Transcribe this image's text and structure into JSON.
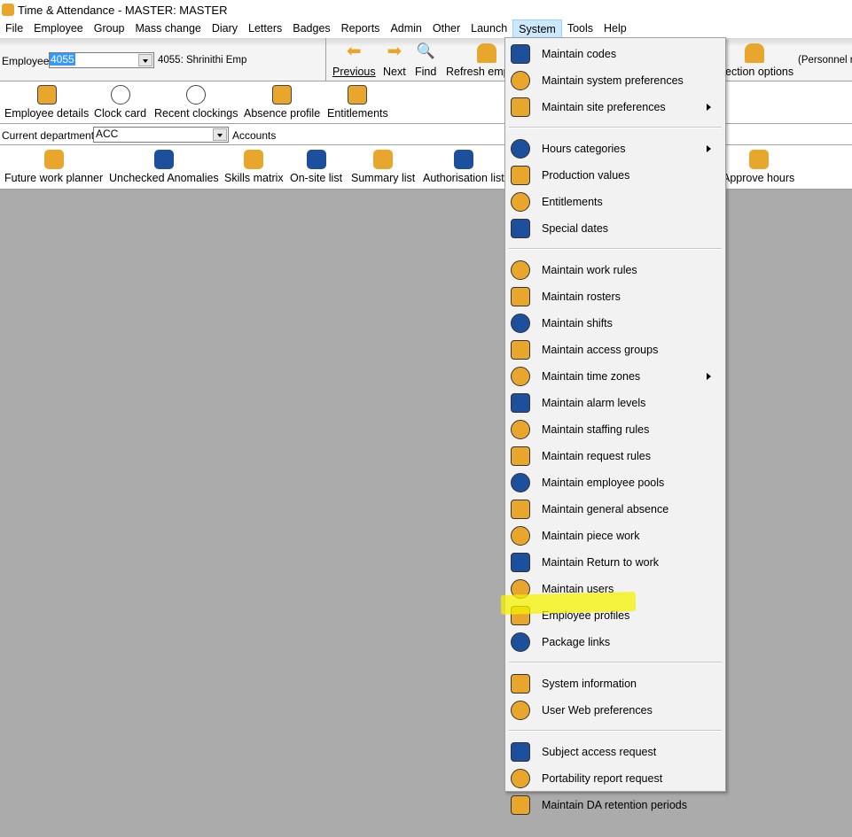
{
  "window": {
    "title": "Time & Attendance - MASTER: MASTER"
  },
  "menubar": [
    "File",
    "Employee",
    "Group",
    "Mass change",
    "Diary",
    "Letters",
    "Badges",
    "Reports",
    "Admin",
    "Other",
    "Launch",
    "System",
    "Tools",
    "Help"
  ],
  "employee": {
    "label": "Employee:",
    "value": "4055",
    "name": "4055: Shrinithi Emp"
  },
  "nav": {
    "previous": "Previous",
    "next": "Next",
    "find": "Find",
    "refresh": "Refresh emp",
    "selection": "ection options",
    "personnel": "(Personnel re"
  },
  "toolbar2": [
    "Employee details",
    "Clock card",
    "Recent clockings",
    "Absence profile",
    "Entitlements"
  ],
  "department": {
    "label": "Current department:",
    "value": "ACC",
    "name": "Accounts"
  },
  "toolbar3": [
    "Future work planner",
    "Unchecked Anomalies",
    "Skills matrix",
    "On-site list",
    "Summary list",
    "Authorisation list",
    "Approve hours"
  ],
  "system_menu": [
    {
      "label": "Maintain codes"
    },
    {
      "label": "Maintain system preferences"
    },
    {
      "label": "Maintain site preferences",
      "submenu": true
    },
    {
      "label": "Hours categories",
      "submenu": true
    },
    {
      "label": "Production values"
    },
    {
      "label": "Entitlements"
    },
    {
      "label": "Special dates"
    },
    {
      "label": "Maintain work rules"
    },
    {
      "label": "Maintain rosters"
    },
    {
      "label": "Maintain shifts"
    },
    {
      "label": "Maintain access groups"
    },
    {
      "label": "Maintain time zones",
      "submenu": true
    },
    {
      "label": "Maintain alarm levels"
    },
    {
      "label": "Maintain staffing rules"
    },
    {
      "label": "Maintain request rules"
    },
    {
      "label": "Maintain employee pools"
    },
    {
      "label": "Maintain general absence"
    },
    {
      "label": "Maintain piece work"
    },
    {
      "label": "Maintain Return to work"
    },
    {
      "label": "Maintain users"
    },
    {
      "label": "Employee profiles",
      "highlighted": true
    },
    {
      "label": "Package links"
    },
    {
      "label": "System information"
    },
    {
      "label": "User Web preferences"
    },
    {
      "label": "Subject access request"
    },
    {
      "label": "Portability report request"
    },
    {
      "label": "Maintain DA retention periods"
    }
  ]
}
